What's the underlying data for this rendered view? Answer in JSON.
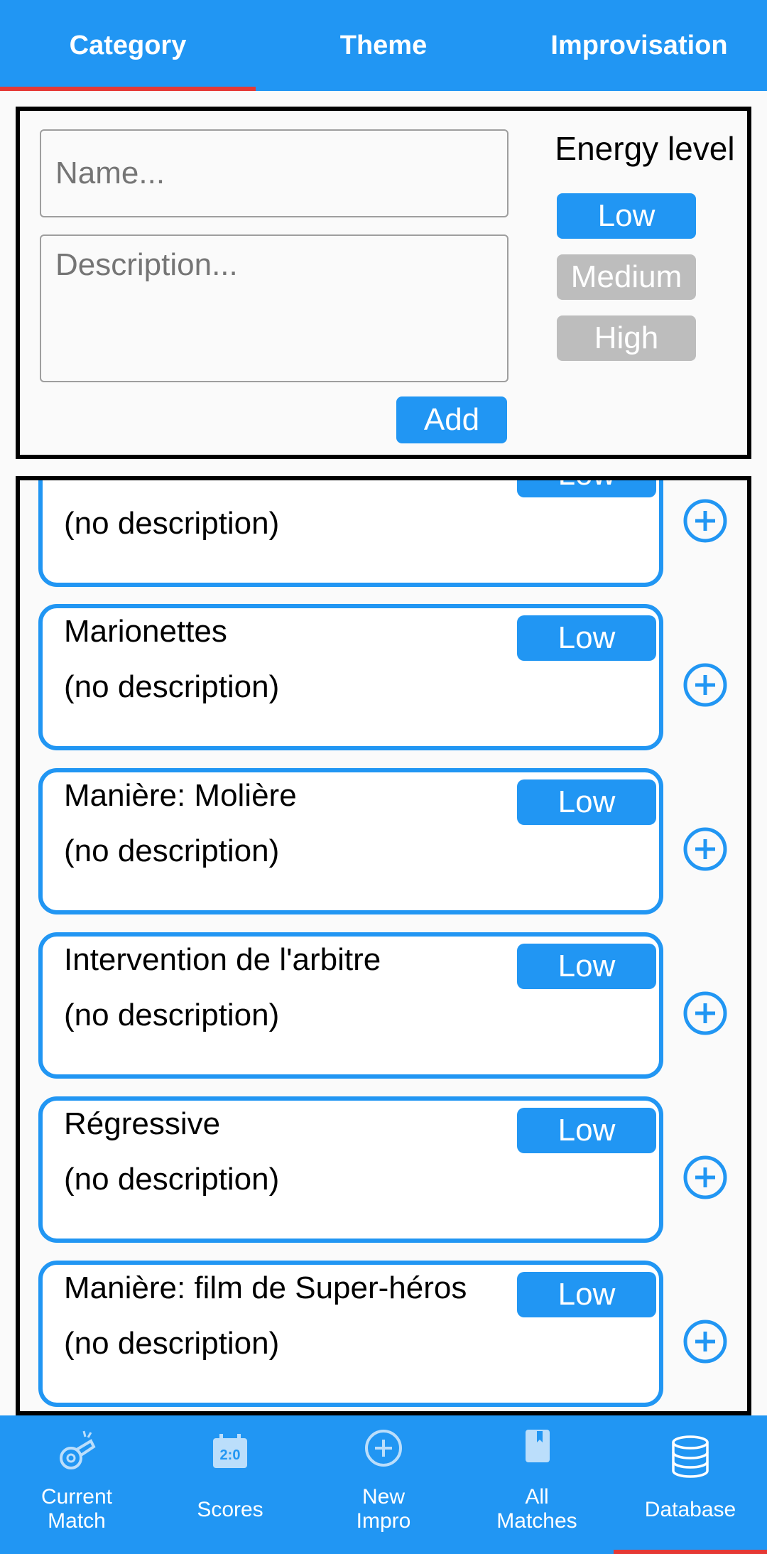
{
  "tabs": [
    "Category",
    "Theme",
    "Improvisation"
  ],
  "form": {
    "name_placeholder": "Name...",
    "description_placeholder": "Description...",
    "energy_title": "Energy level",
    "energy_levels": [
      "Low",
      "Medium",
      "High"
    ],
    "selected_energy": "Low",
    "add_label": "Add"
  },
  "categories": [
    {
      "name": "",
      "description": "(no description)",
      "energy": "Low"
    },
    {
      "name": "Marionettes",
      "description": "(no description)",
      "energy": "Low"
    },
    {
      "name": "Manière: Molière",
      "description": "(no description)",
      "energy": "Low"
    },
    {
      "name": "Intervention de l'arbitre",
      "description": "(no description)",
      "energy": "Low"
    },
    {
      "name": "Régressive",
      "description": "(no description)",
      "energy": "Low"
    },
    {
      "name": "Manière: film de Super-héros",
      "description": "(no description)",
      "energy": "Low"
    }
  ],
  "nav": [
    {
      "label": "Current\nMatch",
      "icon": "whistle-icon"
    },
    {
      "label": "Scores",
      "icon": "scoreboard-icon"
    },
    {
      "label": "New\nImpro",
      "icon": "add-circle-icon"
    },
    {
      "label": "All\nMatches",
      "icon": "book-icon"
    },
    {
      "label": "Database",
      "icon": "database-icon"
    }
  ],
  "colors": {
    "primary": "#2196f3",
    "accent": "#e53935",
    "inactive": "#bdbdbd"
  }
}
